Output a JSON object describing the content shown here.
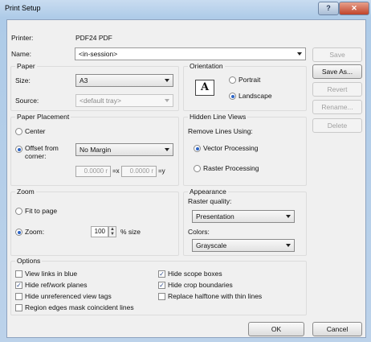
{
  "window": {
    "title": "Print Setup",
    "help_label": "?",
    "close_label": "✕"
  },
  "printer": {
    "label": "Printer:",
    "value": "PDF24 PDF"
  },
  "name": {
    "label": "Name:",
    "value": "<in-session>"
  },
  "actions": {
    "save": "Save",
    "save_as": "Save As...",
    "revert": "Revert",
    "rename": "Rename...",
    "delete": "Delete"
  },
  "paper": {
    "title": "Paper",
    "size_label": "Size:",
    "size_value": "A3",
    "source_label": "Source:",
    "source_value": "<default tray>"
  },
  "orientation": {
    "title": "Orientation",
    "icon_glyph": "A",
    "portrait": "Portrait",
    "landscape": "Landscape",
    "selected": "landscape"
  },
  "placement": {
    "title": "Paper Placement",
    "center": "Center",
    "offset_label": "Offset from corner:",
    "offset_value": "No Margin",
    "x_value": "0.0000 r",
    "x_suffix": "=x",
    "y_value": "0.0000 r",
    "y_suffix": "=y",
    "selected": "offset"
  },
  "hidden_lines": {
    "title": "Hidden Line Views",
    "remove_label": "Remove Lines Using:",
    "vector": "Vector Processing",
    "raster": "Raster Processing",
    "selected": "vector"
  },
  "zoom": {
    "title": "Zoom",
    "fit": "Fit to page",
    "zoom_label": "Zoom:",
    "value": "100",
    "suffix": "% size",
    "selected": "zoom"
  },
  "appearance": {
    "title": "Appearance",
    "raster_label": "Raster quality:",
    "raster_value": "Presentation",
    "colors_label": "Colors:",
    "colors_value": "Grayscale"
  },
  "options": {
    "title": "Options",
    "items": [
      {
        "label": "View links in blue",
        "checked": false
      },
      {
        "label": "Hide scope boxes",
        "checked": true
      },
      {
        "label": "Hide ref/work planes",
        "checked": true
      },
      {
        "label": "Hide crop boundaries",
        "checked": true
      },
      {
        "label": "Hide unreferenced view tags",
        "checked": false
      },
      {
        "label": "Replace halftone with thin lines",
        "checked": false
      },
      {
        "label": "Region edges mask coincident lines",
        "checked": false
      }
    ]
  },
  "footer": {
    "ok": "OK",
    "cancel": "Cancel"
  },
  "colors": {
    "accent": "#2c64c6",
    "title_bar": "#aecbe8",
    "dialog_bg": "#f0f0f0"
  }
}
